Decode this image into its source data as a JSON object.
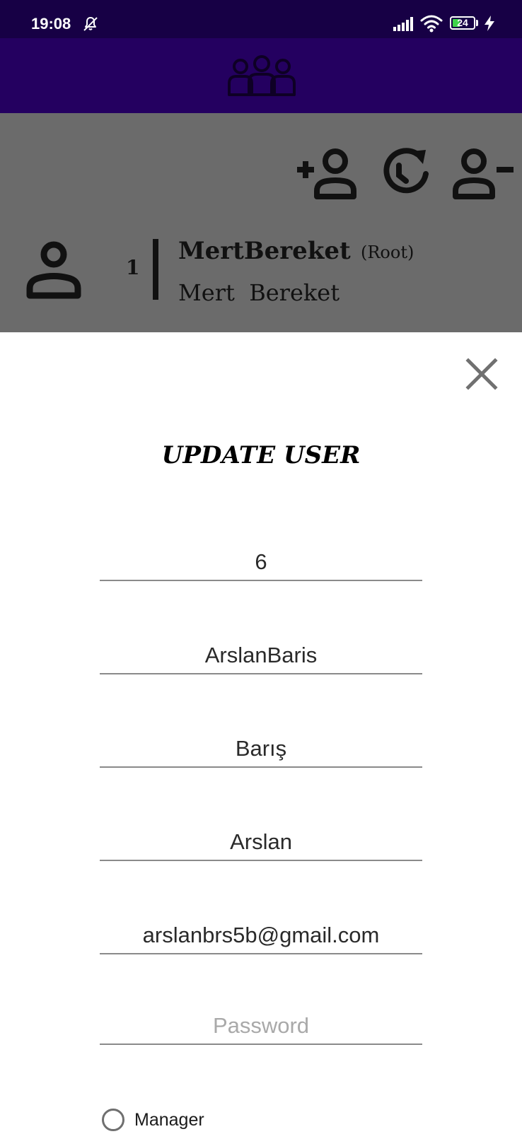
{
  "status_bar": {
    "time": "19:08",
    "battery_percent": "24",
    "icons": [
      "notifications-muted-icon",
      "signal-icon",
      "wifi-icon",
      "battery-icon",
      "charging-icon"
    ]
  },
  "app_bar": {
    "logo_icon": "users-group-icon"
  },
  "toolbar": {
    "icons": [
      "add-user-icon",
      "history-icon",
      "remove-user-icon"
    ]
  },
  "user_row": {
    "id": "1",
    "username": "MertBereket",
    "role": "(Root)",
    "full_name": "Mert  Bereket"
  },
  "update_form": {
    "title": "UPDATE USER",
    "id_value": "6",
    "username_value": "ArslanBaris",
    "first_name_value": "Barış",
    "last_name_value": "Arslan",
    "email_value": "arslanbrs5b@gmail.com",
    "password_value": "",
    "password_placeholder": "Password",
    "manager_label": "Manager",
    "manager_checked": false
  },
  "colors": {
    "status_bar": "#170045",
    "app_bar": "#240060",
    "dim_overlay": "#6b6b6b",
    "battery_fill": "#3ed44a"
  }
}
